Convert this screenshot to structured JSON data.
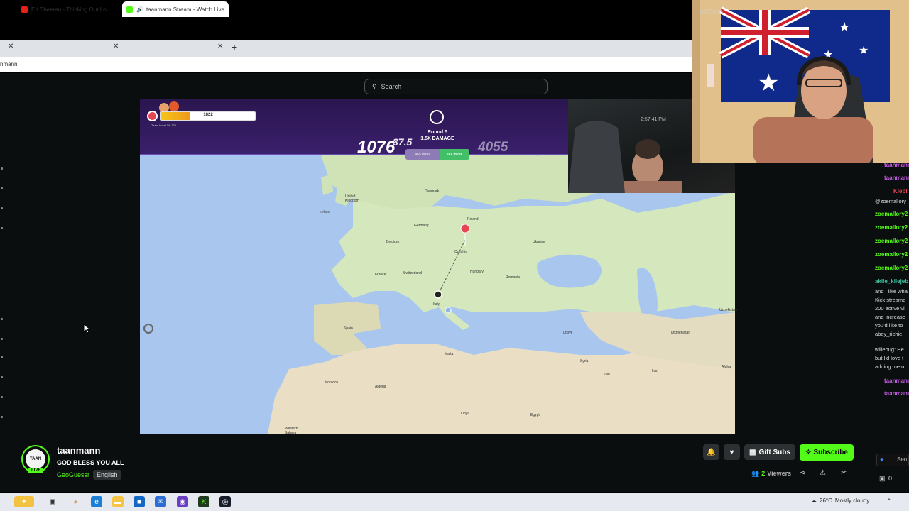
{
  "browser": {
    "tabs": [
      {
        "label": "Ed Sheeran - Thinking Out Loud (O",
        "icon": "youtube-icon",
        "color": "#e62117"
      },
      {
        "label": "taanmann Stream - Watch Live",
        "icon": "kick-icon",
        "color": "#53fc18",
        "audio": true
      }
    ],
    "new_tab": "+",
    "close": "✕",
    "address": "nmann"
  },
  "kick": {
    "search_placeholder": "Search"
  },
  "game": {
    "hud_bar_value": "1822",
    "hud_bar_fraction": 0.3,
    "hud_sub": "Team Ansel 1/6 126",
    "round_label": "Round 5",
    "round_damage": "1.5X DAMAGE",
    "score_left": "1076",
    "score_right": "4055",
    "timer": "37.5",
    "dist_left": "465 miles",
    "dist_right": "241 miles",
    "map_labels": {
      "poland": "Poland",
      "italy": "Italy",
      "spain": "Spain",
      "france": "France",
      "uk": "United Kingdom",
      "turkiye": "Türkiye",
      "algeria": "Algeria",
      "morocco": "Morocco",
      "libya": "Libya",
      "egypt": "Egypt",
      "turkmenistan": "Turkmenistan",
      "uzbekistan": "Uzbekistan",
      "syria": "Syria",
      "iraq": "Iraq",
      "iran": "Iran",
      "hungary": "Hungary",
      "germany": "Germany",
      "romania": "Romania",
      "ukraine": "Ukraine",
      "belgium": "Belgium",
      "switzerland": "Switzerland",
      "denmark": "Denmark",
      "ireland": "Ireland",
      "czechia": "Czechia",
      "malta": "Malta",
      "sahara": "Western Sahara",
      "afghanistan": "Afgha"
    },
    "webcam_time": "2:57:41 PM"
  },
  "webcam": {
    "label": "iVCam"
  },
  "chat": {
    "lines": [
      {
        "text": "taanmann",
        "color": "#c55ce6"
      },
      {
        "text": "taanmann",
        "color": "#c55ce6"
      },
      {
        "text": "Klebl",
        "color": "#e64553"
      },
      {
        "text": "@zoemallory",
        "color": "#dddddd"
      },
      {
        "text": "zoemallory2",
        "color": "#53fc18"
      },
      {
        "text": "zoemallory2",
        "color": "#53fc18"
      },
      {
        "text": "zoemallory2",
        "color": "#53fc18"
      },
      {
        "text": "zoemallory2",
        "color": "#53fc18"
      },
      {
        "text": "zoemallory2",
        "color": "#53fc18"
      },
      {
        "text": "akile_kilejeb",
        "color": "#3fc1a1"
      }
    ],
    "message1": [
      "and I like wha",
      "Kick streame",
      "200 active vi",
      "and increase",
      "you'd like to",
      "abey_richie"
    ],
    "user2": "willebug: He",
    "message2": [
      "but I'd love t",
      "adding me o"
    ],
    "tail": [
      {
        "text": "taanmann",
        "color": "#c55ce6"
      },
      {
        "text": "taanmann",
        "color": "#c55ce6"
      }
    ],
    "send": "Sen",
    "count": "0"
  },
  "stream": {
    "streamer": "taanmann",
    "title": "GOD BLESS YOU ALL",
    "category": "GeoGuessr",
    "language": "English",
    "live": "LIVE",
    "avatar_text": "TAAN MANN",
    "gift_subs": "Gift Subs",
    "subscribe": "Subscribe",
    "viewers_count": "2",
    "viewers_label": "Viewers"
  },
  "taskbar": {
    "weather_temp": "26°C",
    "weather_text": "Mostly cloudy"
  }
}
